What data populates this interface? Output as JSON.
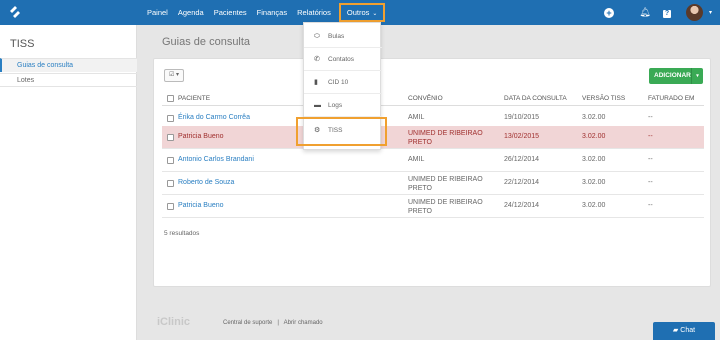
{
  "nav": {
    "items": [
      "Painel",
      "Agenda",
      "Pacientes",
      "Finanças",
      "Relatórios"
    ],
    "outros": "Outros"
  },
  "sidebar": {
    "title": "TISS",
    "items": [
      "Guias de consulta",
      "Lotes"
    ]
  },
  "page": {
    "title": "Guias de consulta"
  },
  "toolbar": {
    "add_label": "ADICIONAR"
  },
  "table": {
    "headers": [
      "PACIENTE",
      "CONVÊNIO",
      "DATA DA CONSULTA",
      "VERSÃO TISS",
      "FATURADO EM"
    ],
    "rows": [
      {
        "paciente": "Érika do Carmo Corrêa",
        "convenio": "AMIL",
        "convenio2": "",
        "data": "19/10/2015",
        "versao": "3.02.00",
        "faturado": "--"
      },
      {
        "paciente": "Patricia Bueno",
        "convenio": "UNIMED DE RIBEIRAO",
        "convenio2": "PRETO",
        "data": "13/02/2015",
        "versao": "3.02.00",
        "faturado": "--"
      },
      {
        "paciente": "Antonio Carlos Brandani",
        "convenio": "AMIL",
        "convenio2": "",
        "data": "26/12/2014",
        "versao": "3.02.00",
        "faturado": "--"
      },
      {
        "paciente": "Roberto de Souza",
        "convenio": "UNIMED DE RIBEIRAO",
        "convenio2": "PRETO",
        "data": "22/12/2014",
        "versao": "3.02.00",
        "faturado": "--"
      },
      {
        "paciente": "Patricia Bueno",
        "convenio": "UNIMED DE RIBEIRAO",
        "convenio2": "PRETO",
        "data": "24/12/2014",
        "versao": "3.02.00",
        "faturado": "--"
      }
    ]
  },
  "results": "5 resultados",
  "dropdown": {
    "items": [
      {
        "label": "Bulas",
        "icon": "pill-icon"
      },
      {
        "label": "Contatos",
        "icon": "phone-icon"
      },
      {
        "label": "CID 10",
        "icon": "document-icon"
      },
      {
        "label": "Logs",
        "icon": "folder-icon"
      },
      {
        "label": "TISS",
        "icon": "gear-icon"
      }
    ]
  },
  "footer": {
    "logo": "iClinic",
    "link1": "Central de suporte",
    "separator": "|",
    "link2": "Abrir chamado"
  },
  "chat": {
    "label": "Chat"
  },
  "colors": {
    "topbar": "#1f6fb2",
    "accent": "#2a7fc2",
    "add_button": "#3aaa55",
    "highlight_row": "#f1d5d6",
    "annotation": "#f0a030"
  }
}
